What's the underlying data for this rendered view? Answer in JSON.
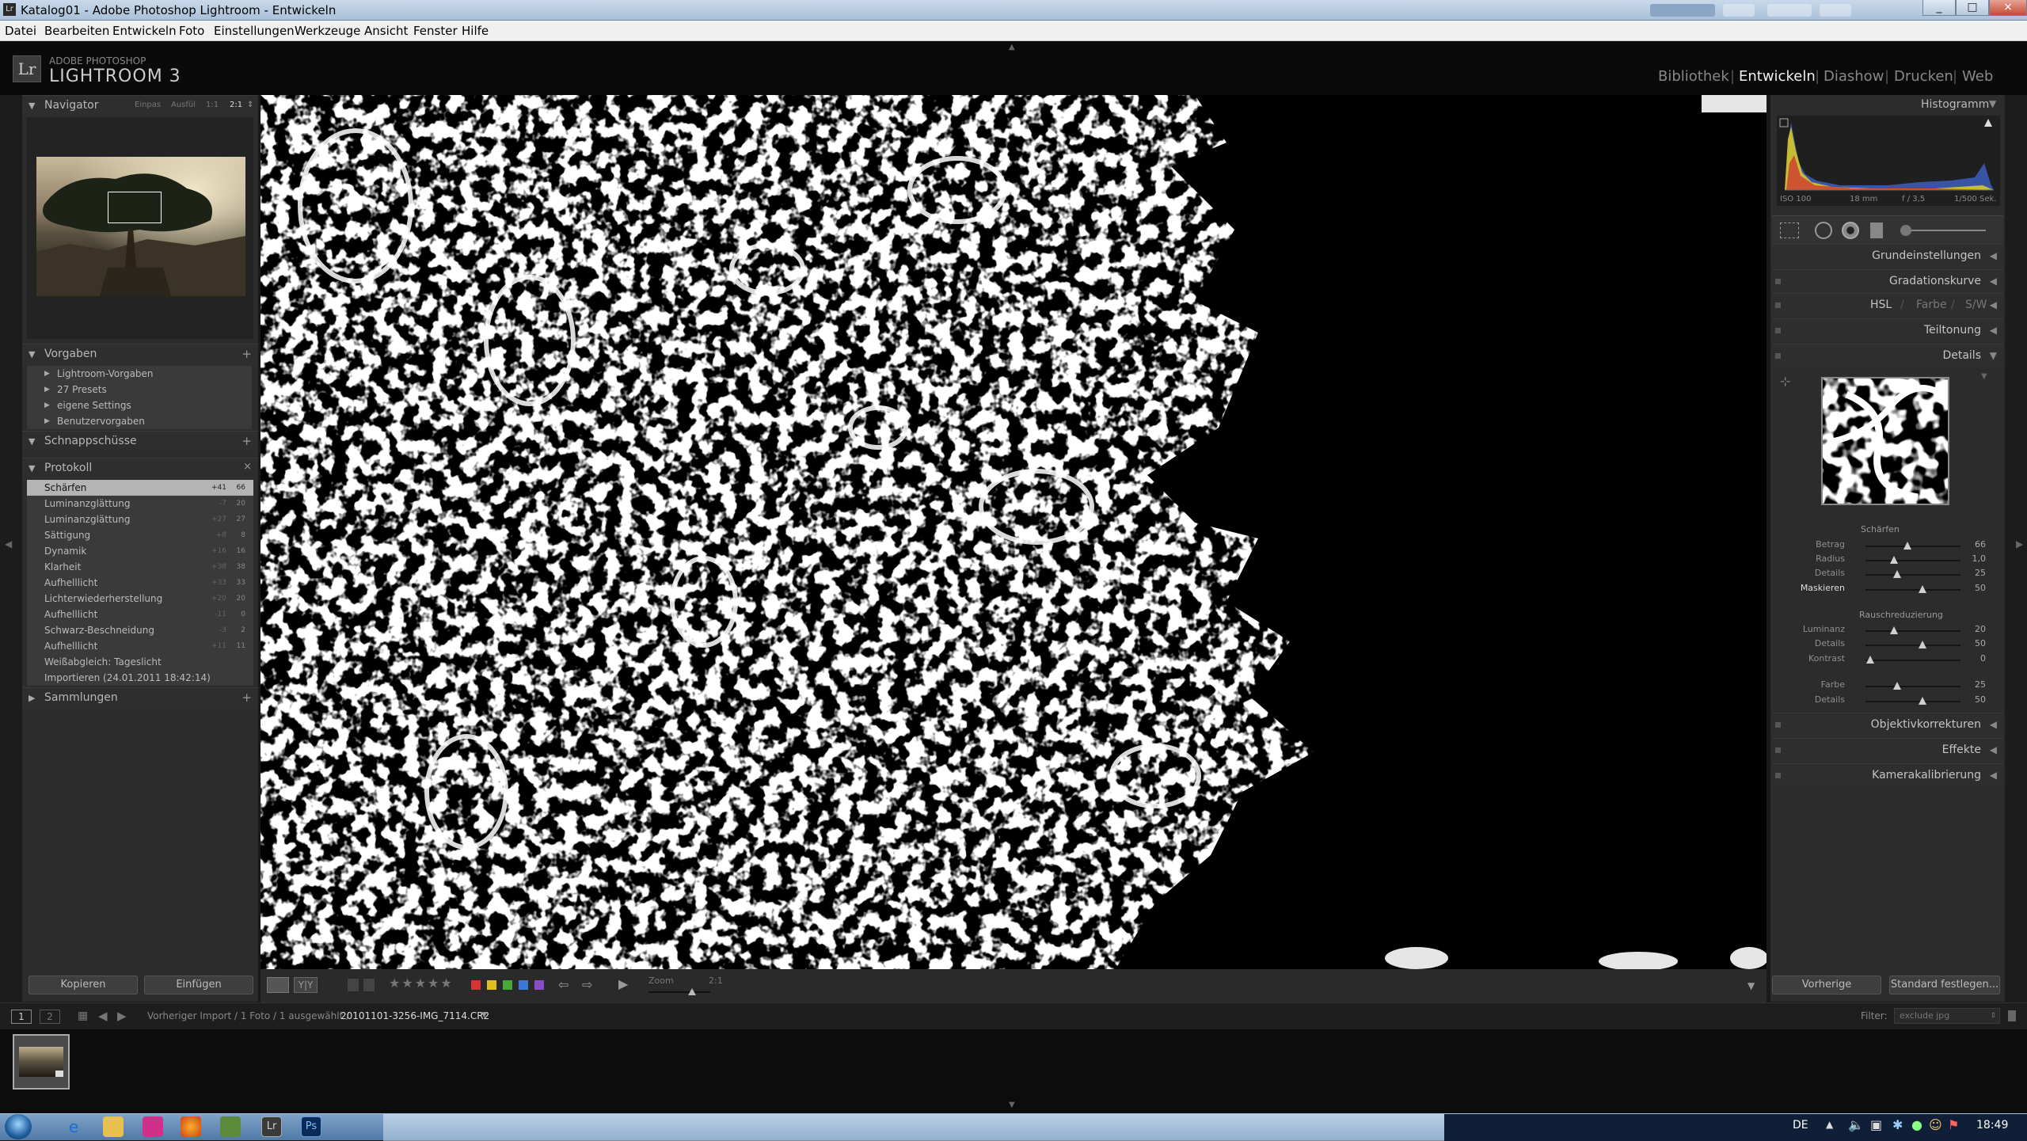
{
  "window": {
    "title": "Katalog01 - Adobe Photoshop Lightroom - Entwickeln",
    "controls": [
      "_",
      "□",
      "×"
    ]
  },
  "menu": [
    "Datei",
    "Bearbeiten",
    "Entwickeln",
    "Foto",
    "Einstellungen",
    "Werkzeuge",
    "Ansicht",
    "Fenster",
    "Hilfe"
  ],
  "app": {
    "logo": "Lr",
    "vendor": "ADOBE PHOTOSHOP",
    "name": "LIGHTROOM 3",
    "modules": [
      "Bibliothek",
      "Entwickeln",
      "Diashow",
      "Drucken",
      "Web"
    ],
    "active_module": "Entwickeln"
  },
  "left": {
    "navigator": {
      "title": "Navigator",
      "options": [
        "Einpas",
        "Ausfül",
        "1:1",
        "2:1"
      ],
      "selected": "2:1"
    },
    "presets": {
      "title": "Vorgaben",
      "items": [
        "Lightroom-Vorgaben",
        "27 Presets",
        "eigene Settings",
        "Benutzervorgaben"
      ]
    },
    "snapshots": {
      "title": "Schnappschüsse"
    },
    "history": {
      "title": "Protokoll",
      "items": [
        {
          "label": "Schärfen",
          "delta": "+41",
          "value": "66"
        },
        {
          "label": "Luminanzglättung",
          "delta": "-7",
          "value": "20"
        },
        {
          "label": "Luminanzglättung",
          "delta": "+27",
          "value": "27"
        },
        {
          "label": "Sättigung",
          "delta": "+8",
          "value": "8"
        },
        {
          "label": "Dynamik",
          "delta": "+16",
          "value": "16"
        },
        {
          "label": "Klarheit",
          "delta": "+38",
          "value": "38"
        },
        {
          "label": "Aufhelllicht",
          "delta": "+33",
          "value": "33"
        },
        {
          "label": "Lichterwiederherstellung",
          "delta": "+20",
          "value": "20"
        },
        {
          "label": "Aufhelllicht",
          "delta": "-11",
          "value": "0"
        },
        {
          "label": "Schwarz-Beschneidung",
          "delta": "-3",
          "value": "2"
        },
        {
          "label": "Aufhelllicht",
          "delta": "+11",
          "value": "11"
        },
        {
          "label": "Weißabgleich: Tageslicht",
          "delta": "",
          "value": ""
        },
        {
          "label": "Importieren (24.01.2011 18:42:14)",
          "delta": "",
          "value": ""
        }
      ]
    },
    "collections": {
      "title": "Sammlungen"
    },
    "copy_btn": "Kopieren",
    "paste_btn": "Einfügen"
  },
  "right": {
    "histogram": {
      "title": "Histogramm",
      "iso": "ISO 100",
      "focal": "18 mm",
      "aperture": "f / 3,5",
      "shutter": "1/500 Sek."
    },
    "panels": {
      "basic": "Grundeinstellungen",
      "tone_curve": "Gradationskurve",
      "hsl": [
        "HSL",
        "Farbe",
        "S/W"
      ],
      "split_toning": "Teiltonung",
      "details": "Details",
      "lens": "Objektivkorrekturen",
      "effects": "Effekte",
      "calibration": "Kamerakalibrierung"
    },
    "sharpen": {
      "title": "Schärfen",
      "rows": [
        {
          "label": "Betrag",
          "value": "66",
          "pos": 0.44
        },
        {
          "label": "Radius",
          "value": "1,0",
          "pos": 0.3
        },
        {
          "label": "Details",
          "value": "25",
          "pos": 0.33
        },
        {
          "label": "Maskieren",
          "value": "50",
          "pos": 0.6
        }
      ]
    },
    "noise": {
      "title": "Rauschreduzierung",
      "rows": [
        {
          "label": "Luminanz",
          "value": "20",
          "pos": 0.3
        },
        {
          "label": "Details",
          "value": "50",
          "pos": 0.6
        },
        {
          "label": "Kontrast",
          "value": "0",
          "pos": 0.05
        },
        {
          "label": "Farbe",
          "value": "25",
          "pos": 0.33
        },
        {
          "label": "Details",
          "value": "50",
          "pos": 0.6
        }
      ]
    },
    "prev_btn": "Vorherige",
    "default_btn": "Standard festlegen..."
  },
  "toolbar": {
    "zoom_label": "Zoom",
    "zoom_value": "2:1",
    "label_colors": [
      "#d83232",
      "#e0c020",
      "#48a838",
      "#3c78d8",
      "#8a4cc8"
    ]
  },
  "filmstrip": {
    "page1": "1",
    "page2": "2",
    "source": "Vorheriger Import / 1 Foto / 1 ausgewählt /",
    "filename": "20101101-3256-IMG_7114.CR2",
    "filter_label": "Filter:",
    "filter_value": "exclude jpg"
  },
  "taskbar": {
    "lang": "DE",
    "clock": "18:49"
  }
}
